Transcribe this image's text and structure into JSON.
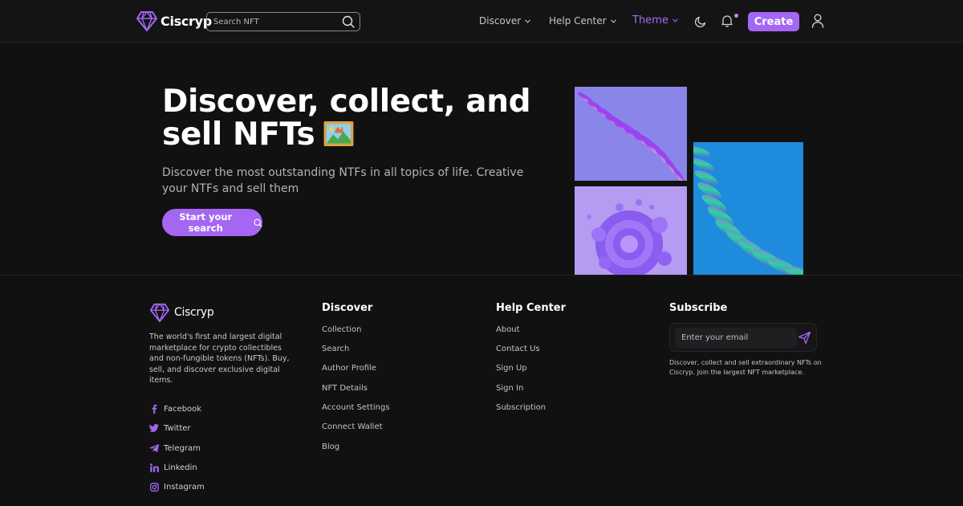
{
  "header": {
    "brand": "Ciscryp",
    "search_placeholder": "Search NFT",
    "nav": {
      "discover": "Discover",
      "help_center": "Help Center",
      "theme": "Theme"
    },
    "create_label": "Create",
    "icons": [
      "diamond-logo-icon",
      "search-icon",
      "chevron-down-icon",
      "moon-icon",
      "bell-icon",
      "user-icon"
    ]
  },
  "hero": {
    "title_line1": "Discover, collect, and",
    "title_line2": "sell NFTs",
    "subtitle": "Discover the most outstanding NTFs in all topics of life. Creative your NTFs and sell them",
    "cta_label": "Start your search"
  },
  "footer": {
    "brand": "Ciscryp",
    "description": "The world's first and largest digital marketplace for crypto collectibles and non-fungible tokens (NFTs). Buy, sell, and discover exclusive digital items.",
    "socials": [
      {
        "label": "Facebook",
        "icon": "facebook-icon"
      },
      {
        "label": "Twitter",
        "icon": "twitter-icon"
      },
      {
        "label": "Telegram",
        "icon": "telegram-icon"
      },
      {
        "label": "Linkedin",
        "icon": "linkedin-icon"
      },
      {
        "label": "Instagram",
        "icon": "instagram-icon"
      }
    ],
    "discover": {
      "title": "Discover",
      "links": [
        "Collection",
        "Search",
        "Author Profile",
        "NFT Details",
        "Account Settings",
        "Connect Wallet",
        "Blog"
      ]
    },
    "help": {
      "title": "Help Center",
      "links": [
        "About",
        "Contact Us",
        "Sign Up",
        "Sign In",
        "Subscription"
      ]
    },
    "subscribe": {
      "title": "Subscribe",
      "placeholder": "Enter your email",
      "description": "Discover, collect and sell extraordinary NFTs on Ciscryp. Join the largest NFT marketplace."
    }
  },
  "colors": {
    "accent": "#a466f3",
    "background": "#111112",
    "header": "#141415"
  }
}
